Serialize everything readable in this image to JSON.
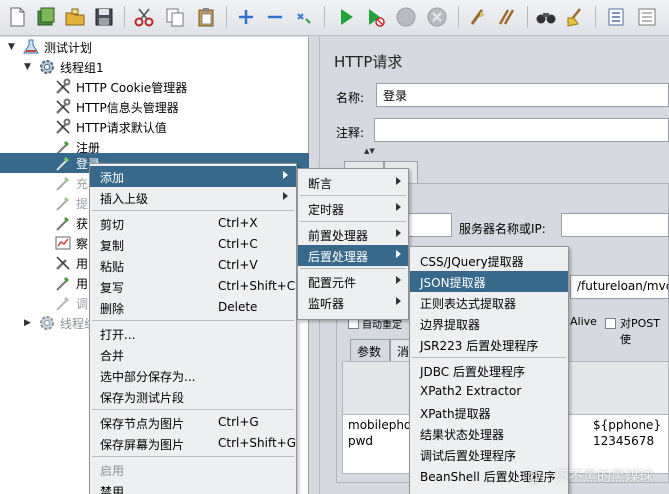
{
  "tree": {
    "items": [
      {
        "label": "测试计划"
      },
      {
        "label": "线程组1"
      },
      {
        "label": "HTTP Cookie管理器"
      },
      {
        "label": "HTTP信息头管理器"
      },
      {
        "label": "HTTP请求默认值"
      },
      {
        "label": "注册"
      },
      {
        "label": "登录"
      },
      {
        "label": "充"
      },
      {
        "label": "提"
      },
      {
        "label": "获"
      },
      {
        "label": "察"
      },
      {
        "label": "用"
      },
      {
        "label": "用"
      },
      {
        "label": "调"
      },
      {
        "label": "线程组"
      }
    ]
  },
  "panel": {
    "title": "HTTP请求",
    "name_label": "名称:",
    "name_value": "登录",
    "comment_label": "注释:",
    "server_label": "服务器名称或IP:",
    "path_value": "/futureloan/mvc/a",
    "alive_label": "Alive",
    "post_label": "对POST使",
    "auto_label": "自动重定",
    "tab_params": "参数",
    "tab_body": "消",
    "params": [
      {
        "name": "mobilephone",
        "value": "${pphone}"
      },
      {
        "name": "pwd",
        "value": "12345678"
      }
    ]
  },
  "menu1": {
    "items": [
      {
        "label": "添加"
      },
      {
        "label": "插入上级"
      },
      {
        "label": "剪切",
        "shortcut": "Ctrl+X"
      },
      {
        "label": "复制",
        "shortcut": "Ctrl+C"
      },
      {
        "label": "粘贴",
        "shortcut": "Ctrl+V"
      },
      {
        "label": "复写",
        "shortcut": "Ctrl+Shift+C"
      },
      {
        "label": "删除",
        "shortcut": "Delete"
      },
      {
        "label": "打开..."
      },
      {
        "label": "合并"
      },
      {
        "label": "选中部分保存为..."
      },
      {
        "label": "保存为测试片段"
      },
      {
        "label": "保存节点为图片",
        "shortcut": "Ctrl+G"
      },
      {
        "label": "保存屏幕为图片",
        "shortcut": "Ctrl+Shift+G"
      },
      {
        "label": "启用"
      },
      {
        "label": "禁用"
      }
    ]
  },
  "menu2": {
    "items": [
      {
        "label": "断言"
      },
      {
        "label": "定时器"
      },
      {
        "label": "前置处理器"
      },
      {
        "label": "后置处理器"
      },
      {
        "label": "配置元件"
      },
      {
        "label": "监听器"
      }
    ]
  },
  "menu3": {
    "items": [
      {
        "label": "CSS/JQuery提取器"
      },
      {
        "label": "JSON提取器"
      },
      {
        "label": "正则表达式提取器"
      },
      {
        "label": "边界提取器"
      },
      {
        "label": "JSR223 后置处理程序"
      },
      {
        "label": "JDBC 后置处理程序"
      },
      {
        "label": "XPath2 Extractor"
      },
      {
        "label": "XPath提取器"
      },
      {
        "label": "结果状态处理器"
      },
      {
        "label": "调试后置处理程序"
      },
      {
        "label": "BeanShell 后置处理程序"
      }
    ]
  },
  "watermark": "@一只不黑的黑煤球",
  "colors": {
    "selection": "#39698a",
    "menu_bg": "#eeeff1"
  }
}
